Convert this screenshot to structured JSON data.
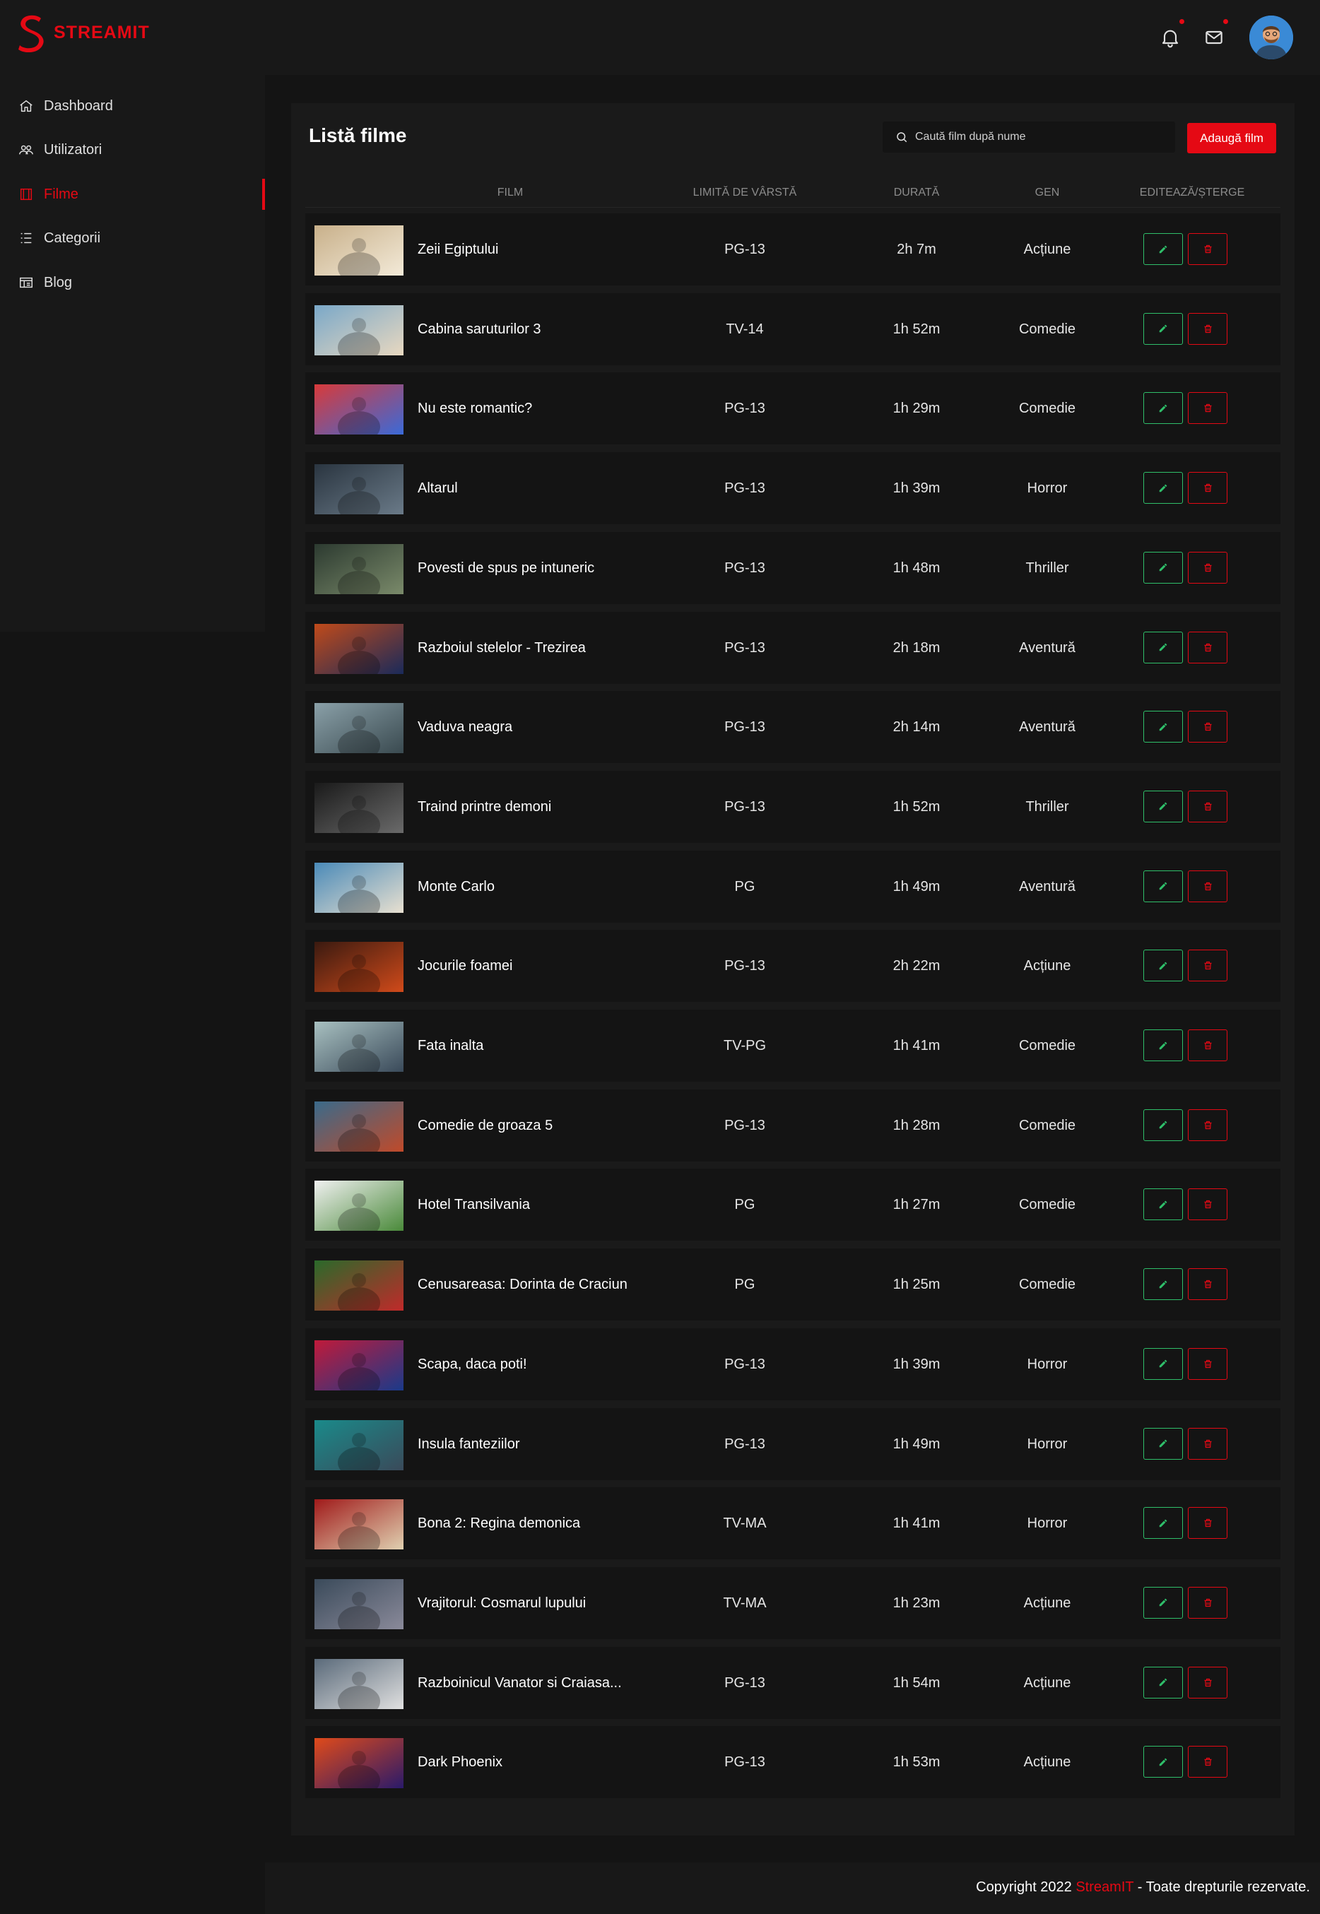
{
  "brand": {
    "name": "STREAMIT",
    "accent_color": "#e50914"
  },
  "header": {
    "notifications_icon": "bell-icon",
    "messages_icon": "mail-icon",
    "avatar_icon": "user-avatar"
  },
  "sidebar": {
    "items": [
      {
        "label": "Dashboard",
        "icon": "home-icon",
        "active": false
      },
      {
        "label": "Utilizatori",
        "icon": "users-icon",
        "active": false
      },
      {
        "label": "Filme",
        "icon": "film-icon",
        "active": true
      },
      {
        "label": "Categorii",
        "icon": "list-icon",
        "active": false
      },
      {
        "label": "Blog",
        "icon": "blog-icon",
        "active": false
      }
    ]
  },
  "main": {
    "title": "Listă filme",
    "search_placeholder": "Caută film după nume",
    "add_button": "Adaugă film",
    "columns": [
      "FILM",
      "LIMITĂ DE VÂRSTĂ",
      "DURATĂ",
      "GEN",
      "EDITEAZĂ/ȘTERGE"
    ],
    "movies": [
      {
        "title": "Zeii Egiptului",
        "age": "PG-13",
        "duration": "2h 7m",
        "genre": "Acțiune"
      },
      {
        "title": "Cabina saruturilor 3",
        "age": "TV-14",
        "duration": "1h 52m",
        "genre": "Comedie"
      },
      {
        "title": "Nu este romantic?",
        "age": "PG-13",
        "duration": "1h 29m",
        "genre": "Comedie"
      },
      {
        "title": "Altarul",
        "age": "PG-13",
        "duration": "1h 39m",
        "genre": "Horror"
      },
      {
        "title": "Povesti de spus pe intuneric",
        "age": "PG-13",
        "duration": "1h 48m",
        "genre": "Thriller"
      },
      {
        "title": "Razboiul stelelor - Trezirea",
        "age": "PG-13",
        "duration": "2h 18m",
        "genre": "Aventură"
      },
      {
        "title": "Vaduva neagra",
        "age": "PG-13",
        "duration": "2h 14m",
        "genre": "Aventură"
      },
      {
        "title": "Traind printre demoni",
        "age": "PG-13",
        "duration": "1h 52m",
        "genre": "Thriller"
      },
      {
        "title": "Monte Carlo",
        "age": "PG",
        "duration": "1h 49m",
        "genre": "Aventură"
      },
      {
        "title": "Jocurile foamei",
        "age": "PG-13",
        "duration": "2h 22m",
        "genre": "Acțiune"
      },
      {
        "title": "Fata inalta",
        "age": "TV-PG",
        "duration": "1h 41m",
        "genre": "Comedie"
      },
      {
        "title": "Comedie de groaza 5",
        "age": "PG-13",
        "duration": "1h 28m",
        "genre": "Comedie"
      },
      {
        "title": "Hotel Transilvania",
        "age": "PG",
        "duration": "1h 27m",
        "genre": "Comedie"
      },
      {
        "title": "Cenusareasa: Dorinta de Craciun",
        "age": "PG",
        "duration": "1h 25m",
        "genre": "Comedie"
      },
      {
        "title": "Scapa, daca poti!",
        "age": "PG-13",
        "duration": "1h 39m",
        "genre": "Horror"
      },
      {
        "title": "Insula fanteziilor",
        "age": "PG-13",
        "duration": "1h 49m",
        "genre": "Horror"
      },
      {
        "title": "Bona 2: Regina demonica",
        "age": "TV-MA",
        "duration": "1h 41m",
        "genre": "Horror"
      },
      {
        "title": "Vrajitorul: Cosmarul lupului",
        "age": "TV-MA",
        "duration": "1h 23m",
        "genre": "Acțiune"
      },
      {
        "title": "Razboinicul Vanator si Craiasa...",
        "age": "PG-13",
        "duration": "1h 54m",
        "genre": "Acțiune"
      },
      {
        "title": "Dark Phoenix",
        "age": "PG-13",
        "duration": "1h 53m",
        "genre": "Acțiune"
      }
    ]
  },
  "footer": {
    "prefix": "Copyright 2022 ",
    "brand": "StreamIT",
    "suffix": " - Toate drepturile rezervate."
  }
}
